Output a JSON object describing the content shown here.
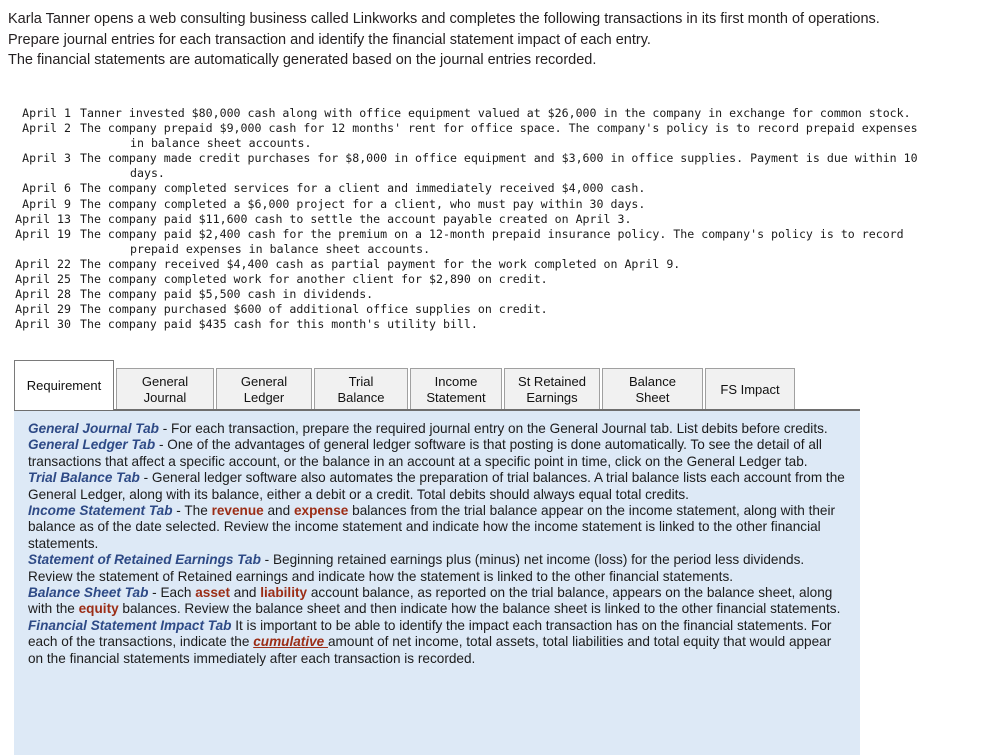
{
  "intro": {
    "lines": [
      "Karla Tanner opens a web consulting business called Linkworks and completes the following transactions in its first month of operations.",
      "Prepare journal entries for each transaction and identify the financial statement impact of each entry.",
      "The financial statements are automatically generated based on the journal entries recorded."
    ]
  },
  "transactions": [
    {
      "date": "April 1",
      "text": "Tanner invested $80,000 cash along with office equipment valued at $26,000 in the company in exchange for common stock.",
      "cont": ""
    },
    {
      "date": "April 2",
      "text": "The company prepaid $9,000 cash for 12 months' rent for office space. The company's policy is to record prepaid expenses",
      "cont": "in balance sheet accounts."
    },
    {
      "date": "April 3",
      "text": "The company made credit purchases for $8,000 in office equipment and $3,600 in office supplies. Payment is due within 10",
      "cont": "days."
    },
    {
      "date": "April 6",
      "text": "The company completed services for a client and immediately received $4,000 cash.",
      "cont": ""
    },
    {
      "date": "April 9",
      "text": "The company completed a $6,000 project for a client, who must pay within 30 days.",
      "cont": ""
    },
    {
      "date": "April 13",
      "text": "The company paid $11,600 cash to settle the account payable created on April 3.",
      "cont": ""
    },
    {
      "date": "April 19",
      "text": "The company paid $2,400 cash for the premium on a 12-month prepaid insurance policy. The company's policy is to record",
      "cont": "prepaid expenses in balance sheet accounts."
    },
    {
      "date": "April 22",
      "text": "The company received $4,400 cash as partial payment for the work completed on April 9.",
      "cont": ""
    },
    {
      "date": "April 25",
      "text": "The company completed work for another client for $2,890 on credit.",
      "cont": ""
    },
    {
      "date": "April 28",
      "text": "The company paid $5,500 cash in dividends.",
      "cont": ""
    },
    {
      "date": "April 29",
      "text": "The company purchased $600 of additional office supplies on credit.",
      "cont": ""
    },
    {
      "date": "April 30",
      "text": "The company paid $435 cash for this month's utility bill.",
      "cont": ""
    }
  ],
  "tabs": [
    {
      "label": "Requirement",
      "active": true
    },
    {
      "label": "General\nJournal",
      "active": false
    },
    {
      "label": "General\nLedger",
      "active": false
    },
    {
      "label": "Trial Balance",
      "active": false
    },
    {
      "label": "Income\nStatement",
      "active": false
    },
    {
      "label": "St Retained\nEarnings",
      "active": false
    },
    {
      "label": "Balance Sheet",
      "active": false
    },
    {
      "label": "FS Impact",
      "active": false
    }
  ],
  "panel": {
    "gj_heading": "General Journal Tab",
    "gj_body": " - For each transaction, prepare the required journal entry on the General Journal tab. List debits before credits.",
    "gl_heading": "General Ledger Tab",
    "gl_body": " - One of the advantages of general ledger software is that posting is done automatically. To see the detail of all transactions that affect a specific account, or the balance in an account at a specific point in time, click on the General Ledger tab.",
    "tb_heading": "Trial Balance Tab",
    "tb_body": " - General ledger software also automates the preparation of trial balances. A trial balance lists each account from the General Ledger, along with its balance, either a debit or a credit. Total debits should always equal total credits.",
    "is_heading": "Income Statement Tab",
    "is_body_1": " - The ",
    "is_red_1": "revenue",
    "is_body_2": " and ",
    "is_red_2": "expense",
    "is_body_3": " balances from the trial balance appear on the income statement, along with their balance as of the date selected. Review the income statement and indicate how the income statement is linked to the other financial statements.",
    "sre_heading": "Statement of Retained Earnings Tab",
    "sre_body": " - Beginning retained earnings plus (minus) net income (loss) for the period less dividends. Review the statement of Retained earnings and indicate how the statement is linked to the other financial statements.",
    "bs_heading": "Balance Sheet Tab",
    "bs_body_1": " - Each ",
    "bs_red_1": "asset",
    "bs_body_2": " and ",
    "bs_red_2": "liability",
    "bs_body_3": " account balance, as reported on the trial balance, appears on the balance sheet, along with the ",
    "bs_red_3": "equity",
    "bs_body_4": " balances. Review the balance sheet and then indicate how the balance sheet is linked to the other financial statements.",
    "fs_heading": "Financial Statement Impact Tab",
    "fs_body_1": " It is important to be able to identify the impact each transaction has on the financial statements. For each of the transactions, indicate the ",
    "fs_red_1": "cumulative ",
    "fs_body_2": "amount of net income, total assets, total liabilities and total equity that would appear on the financial statements immediately after each transaction is recorded."
  },
  "colors": {
    "heading_blue": "#2e4a86",
    "accent_red": "#9b2d16",
    "panel_bg": "#dde9f6",
    "tab_inactive_bg": "#f1f1f1",
    "tab_active_bg": "#ffffff",
    "tab_border": "#a0a0a0"
  }
}
